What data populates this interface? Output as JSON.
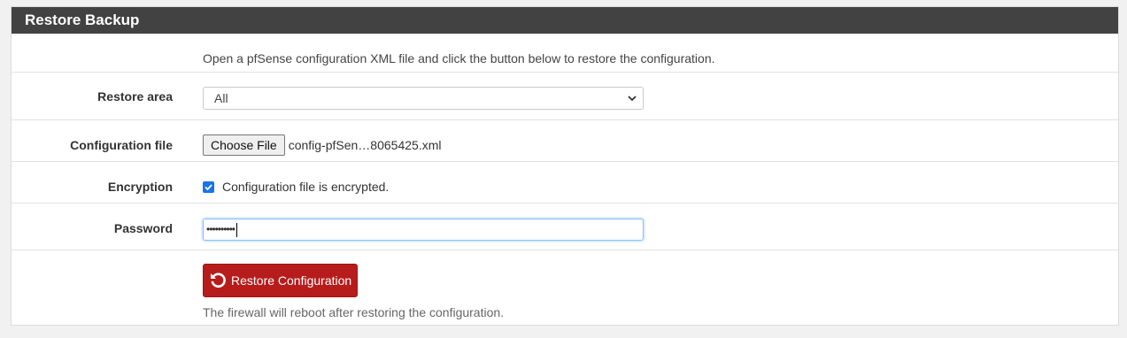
{
  "panel": {
    "title": "Restore Backup"
  },
  "intro": {
    "text": "Open a pfSense configuration XML file and click the button below to restore the configuration."
  },
  "restore_area": {
    "label": "Restore area",
    "selected": "All"
  },
  "config_file": {
    "label": "Configuration file",
    "button_label": "Choose File",
    "file_name": "config-pfSen…8065425.xml"
  },
  "encryption": {
    "label": "Encryption",
    "checked": true,
    "checkbox_label": "Configuration file is encrypted."
  },
  "password": {
    "label": "Password",
    "value_masked": "••••••••••"
  },
  "restore_button": {
    "label": "Restore Configuration",
    "icon": "undo-icon"
  },
  "help": {
    "text": "The firewall will reboot after restoring the configuration."
  },
  "colors": {
    "header_bg": "#424242",
    "danger": "#b71c1c",
    "checkbox": "#1a73e8",
    "focus": "#80bdff"
  }
}
